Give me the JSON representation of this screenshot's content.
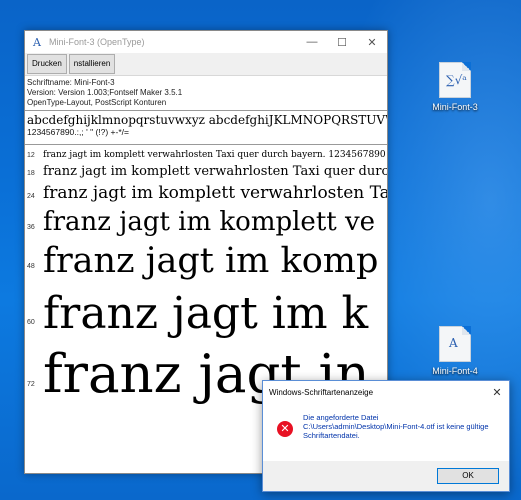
{
  "desktop": {
    "icons": [
      {
        "label": "Mini-Font-3",
        "glyph": "∑√ᵃ"
      },
      {
        "label": "Mini-Font-4",
        "glyph": "A"
      }
    ]
  },
  "window": {
    "title": "Mini-Font-3 (OpenType)",
    "controls": {
      "minimize": "—",
      "maximize": "☐",
      "close": "✕"
    },
    "toolbar": {
      "print": "Drucken",
      "install": "nstallieren"
    },
    "info": {
      "name": "Schriftname: Mini-Font-3",
      "version": "Version: Version 1.003;Fontself Maker 3.5.1",
      "layout": "OpenType-Layout, PostScript Konturen"
    },
    "sample": {
      "line1": "abcdefghijklmnopqrstuvwxyz abcdefghiJKLMNOPQRSTUVWXYZ",
      "line2": "1234567890.:,; ' \" (!?) +-*/="
    },
    "waterfall": [
      {
        "size": "12",
        "text": "franz jagt im komplett verwahrlosten Taxi quer durch bayern. 1234567890"
      },
      {
        "size": "18",
        "text": "franz jagt im komplett verwahrlosten Taxi quer durch"
      },
      {
        "size": "24",
        "text": "franz jagt im komplett verwahrlosten Tax"
      },
      {
        "size": "36",
        "text": "franz jagt im komplett ve"
      },
      {
        "size": "48",
        "text": "franz jagt im komp"
      },
      {
        "size": "60",
        "text": "franz jagt im k"
      },
      {
        "size": "72",
        "text": "franz jagt in"
      }
    ]
  },
  "dialog": {
    "title": "Windows-Schriftartenanzeige",
    "close": "✕",
    "error_icon": "✕",
    "message_line1": "Die angeforderte Datei",
    "message_line2": "C:\\Users\\admin\\Desktop\\Mini-Font-4.otf ist keine gültige",
    "message_line3": "Schriftartendatei.",
    "ok_label": "OK"
  }
}
